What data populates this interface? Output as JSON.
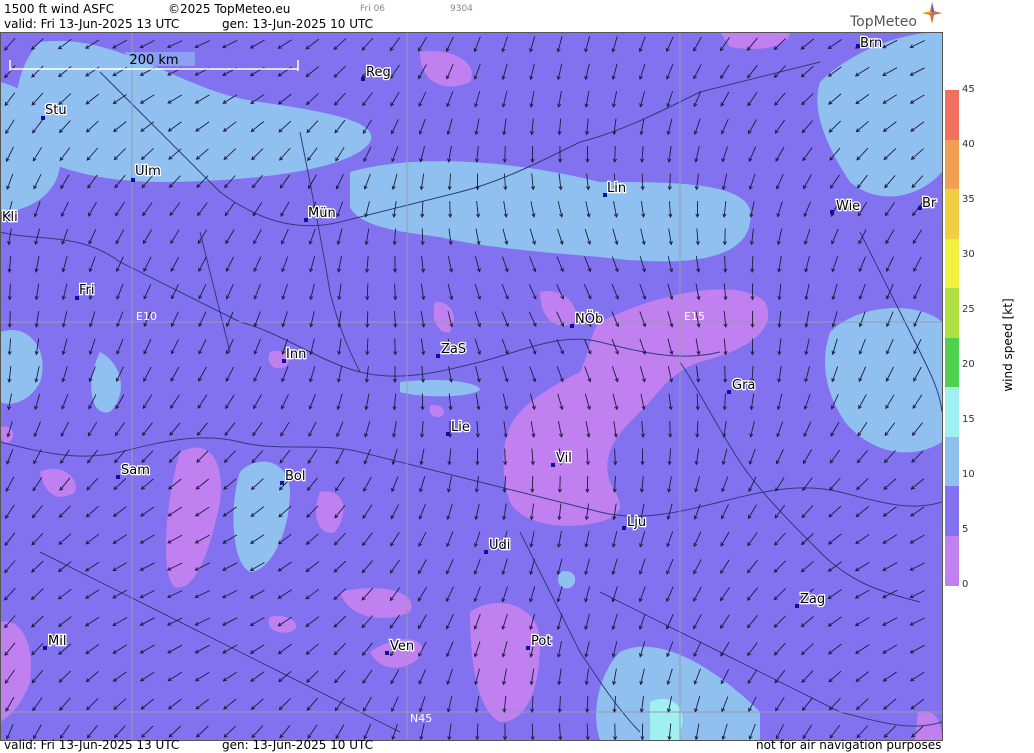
{
  "header": {
    "product": "1500 ft wind ASFC",
    "copyright": "©2025 TopMeteo.eu",
    "day_tag": "Fri 06",
    "code": "9304",
    "valid": "valid:  Fri  13-Jun-2025  13 UTC",
    "generated": "gen: 13-Jun-2025 10 UTC"
  },
  "logo": {
    "text": "TopMeteo",
    "icon": "compass-star-icon"
  },
  "scale_bar": {
    "label": "200 km"
  },
  "grid_labels": {
    "e10": "E10",
    "e15": "E15",
    "n45": "N45"
  },
  "cities": [
    {
      "name": "Brn"
    },
    {
      "name": "Reg"
    },
    {
      "name": "Stu"
    },
    {
      "name": "Ulm"
    },
    {
      "name": "Lin"
    },
    {
      "name": "Kli"
    },
    {
      "name": "Mün"
    },
    {
      "name": "Wie"
    },
    {
      "name": "Br"
    },
    {
      "name": "Fri"
    },
    {
      "name": "NÖb"
    },
    {
      "name": "Inn"
    },
    {
      "name": "ZaS"
    },
    {
      "name": "Gra"
    },
    {
      "name": "Lie"
    },
    {
      "name": "Vil"
    },
    {
      "name": "Sam"
    },
    {
      "name": "Bol"
    },
    {
      "name": "Lju"
    },
    {
      "name": "Udi"
    },
    {
      "name": "Zag"
    },
    {
      "name": "Mil"
    },
    {
      "name": "Ven"
    },
    {
      "name": "Pot"
    }
  ],
  "legend": {
    "title": "wind  speed  [kt]",
    "ticks": [
      "45",
      "40",
      "35",
      "30",
      "25",
      "20",
      "15",
      "10",
      "5",
      "0"
    ],
    "colors": [
      "#f07060",
      "#f0a050",
      "#f0d040",
      "#f0f040",
      "#b0e040",
      "#50d050",
      "#a0f0f0",
      "#90c0f0",
      "#8272f0",
      "#c080f0"
    ]
  },
  "colors": {
    "base": "#8272f0",
    "light_blue": "#90c0f0",
    "magenta": "#c080f0",
    "cyan": "#a0f0f0"
  },
  "footer": {
    "valid": "valid:  Fri  13-Jun-2025  13 UTC",
    "generated": "gen: 13-Jun-2025 10 UTC",
    "disclaimer": "not for air navigation purposes"
  }
}
